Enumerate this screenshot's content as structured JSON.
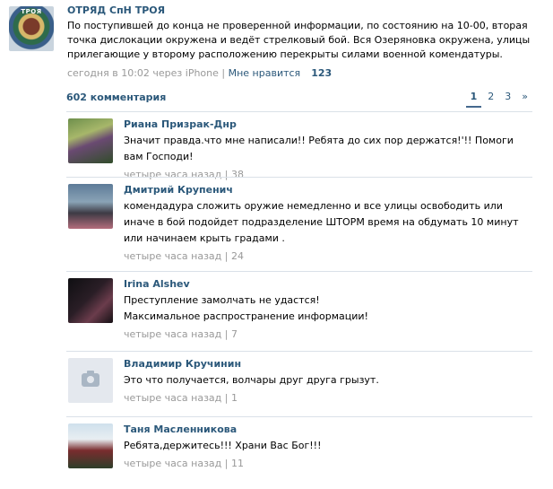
{
  "post": {
    "author": "ОТРЯД СпН ТРОЯ",
    "avatar_text": "ТРОЯ",
    "text": "По поступившей до конца не проверенной информации, по состоянию на 10-00, вторая точка дислокации окружена и ведёт стрелковый бой. Вся Озеряновка окружена, улицы прилегающие у второму расположению перекрыты силами военной комендатуры.",
    "meta": "сегодня в 10:02 через iPhone | ",
    "like_label": "Мне нравится",
    "like_count": "123"
  },
  "comments_header": {
    "count_label": "602 комментария",
    "pages": [
      "1",
      "2",
      "3",
      "»"
    ]
  },
  "comments": [
    {
      "name": "Риана Призрак-Днр",
      "text": "Значит правда.что мне написали!! Ребята до сих пор держатся!'!! Помоги вам Господи!",
      "time": "четыре часа назад",
      "likes": "38"
    },
    {
      "name": "Дмитрий Крупенич",
      "text": "комендадура сложить оружие немедленно и все улицы освободить или иначе в бой подойдет подразделение ШТОРМ время на обдумать 10 минут или начинаем крыть градами .",
      "time": "четыре часа назад",
      "likes": "24"
    },
    {
      "name": "Irina Alshev",
      "text": "Преступление замолчать не удастся!\nМаксимальное распространение информации!",
      "time": "четыре часа назад",
      "likes": "7"
    },
    {
      "name": "Владимир Кручинин",
      "text": "Это что получается, волчары друг друга грызут.",
      "time": "четыре часа назад",
      "likes": "1"
    },
    {
      "name": "Таня Масленникова",
      "text": "Ребята,держитесь!!! Храни Вас Бог!!!",
      "time": "четыре часа назад",
      "likes": "11"
    }
  ]
}
